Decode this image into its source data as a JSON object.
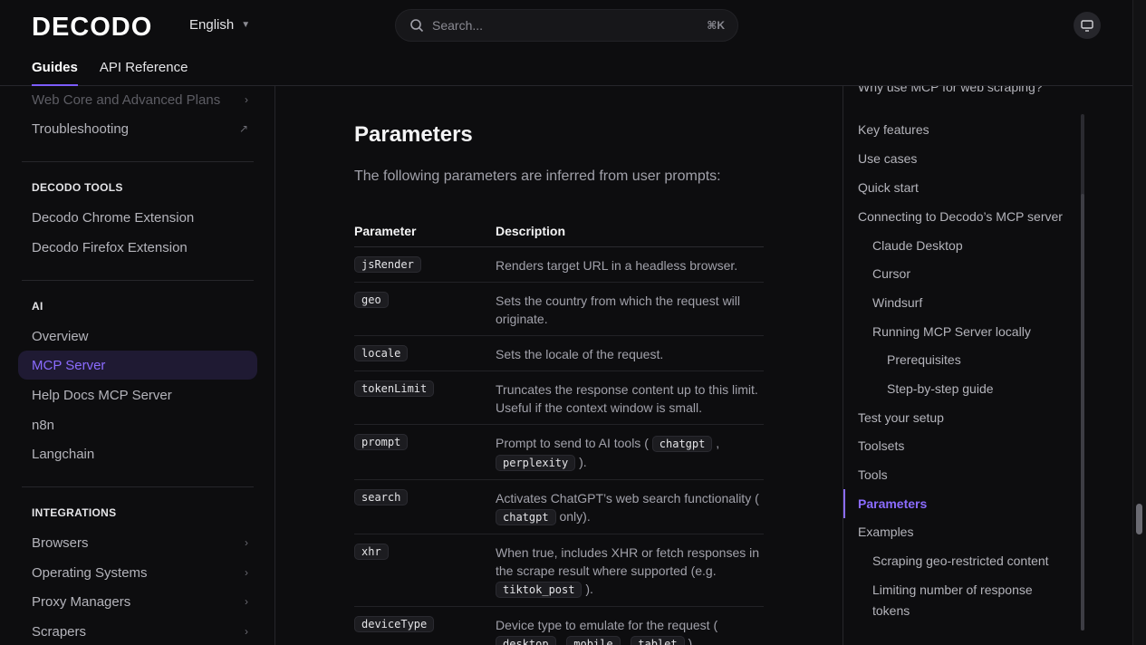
{
  "header": {
    "logo": "DECODO",
    "language": "English",
    "search_placeholder": "Search...",
    "search_shortcut": "⌘K",
    "tabs": [
      {
        "label": "Guides"
      },
      {
        "label": "API Reference"
      }
    ]
  },
  "sidebar": {
    "items_top": [
      {
        "label": "Web Core and Advanced Plans"
      },
      {
        "label": "Troubleshooting"
      }
    ],
    "section_tools": "DECODO TOOLS",
    "tools": [
      {
        "label": "Decodo Chrome Extension"
      },
      {
        "label": "Decodo Firefox Extension"
      }
    ],
    "section_ai": "AI",
    "ai": [
      {
        "label": "Overview"
      },
      {
        "label": "MCP Server"
      },
      {
        "label": "Help Docs MCP Server"
      },
      {
        "label": "n8n"
      },
      {
        "label": "Langchain"
      }
    ],
    "section_integrations": "INTEGRATIONS",
    "integrations": [
      {
        "label": "Browsers"
      },
      {
        "label": "Operating Systems"
      },
      {
        "label": "Proxy Managers"
      },
      {
        "label": "Scrapers"
      }
    ]
  },
  "main": {
    "heading": "Parameters",
    "intro": "The following parameters are inferred from user prompts:",
    "columns": [
      "Parameter",
      "Description"
    ],
    "rows": [
      {
        "param": "jsRender",
        "desc": [
          "Renders target URL in a headless browser."
        ]
      },
      {
        "param": "geo",
        "desc": [
          "Sets the country from which the request will originate."
        ]
      },
      {
        "param": "locale",
        "desc": [
          "Sets the locale of the request."
        ]
      },
      {
        "param": "tokenLimit",
        "desc": [
          "Truncates the response content up to this limit. Useful if the context window is small."
        ]
      },
      {
        "param": "prompt",
        "desc": [
          "Prompt to send to AI tools ( ",
          "chatgpt",
          " , ",
          "perplexity",
          " )."
        ]
      },
      {
        "param": "search",
        "desc": [
          "Activates ChatGPT’s web search functionality ( ",
          "chatgpt",
          " only)."
        ]
      },
      {
        "param": "xhr",
        "desc": [
          "When true, includes XHR or fetch responses in the scrape result where supported (e.g. ",
          "tiktok_post",
          " )."
        ]
      },
      {
        "param": "deviceType",
        "desc": [
          "Device type to emulate for the request ( ",
          "desktop",
          " , ",
          "mobile",
          " , ",
          "tablet",
          " )."
        ]
      }
    ]
  },
  "toc": {
    "items": [
      {
        "label": "Why use MCP for web scraping?"
      },
      {
        "label": "Key features"
      },
      {
        "label": "Use cases"
      },
      {
        "label": "Quick start"
      },
      {
        "label": "Connecting to Decodo’s MCP server"
      },
      {
        "label": "Claude Desktop"
      },
      {
        "label": "Cursor"
      },
      {
        "label": "Windsurf"
      },
      {
        "label": "Running MCP Server locally"
      },
      {
        "label": "Prerequisites"
      },
      {
        "label": "Step-by-step guide"
      },
      {
        "label": "Test your setup"
      },
      {
        "label": "Toolsets"
      },
      {
        "label": "Tools"
      },
      {
        "label": "Parameters"
      },
      {
        "label": "Examples"
      },
      {
        "label": "Scraping geo-restricted content"
      },
      {
        "label": "Limiting number of response"
      },
      {
        "label": "tokens"
      }
    ]
  }
}
